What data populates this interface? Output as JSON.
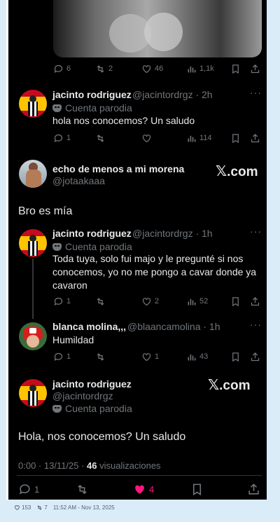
{
  "top_tweet": {
    "replies": "6",
    "retweets": "2",
    "likes": "46",
    "views": "1,1k"
  },
  "reply1": {
    "name": "jacinto rodriguez",
    "handle": "@jacintordrgz · 2h",
    "parody": "Cuenta parodia",
    "text": "hola nos conocemos? Un saludo",
    "replies": "1",
    "retweets": "",
    "likes": "",
    "views": "114"
  },
  "embed1": {
    "name": "echo de menos a mi morena",
    "handle": "@jotaakaaa",
    "brand": ".com",
    "text": "Bro es mía"
  },
  "reply2": {
    "name": "jacinto rodriguez",
    "handle": "@jacintordrgz · 1h",
    "parody": "Cuenta parodia",
    "text": "Toda tuya, solo fui majo y le pregunté si nos conocemos, yo no me pongo a cavar donde ya cavaron",
    "replies": "1",
    "retweets": "",
    "likes": "2",
    "views": "52"
  },
  "reply3": {
    "name": "blanca molina,,,",
    "handle": "@blaancamolina · 1h",
    "text": "Humildad",
    "replies": "1",
    "retweets": "",
    "likes": "1",
    "views": "43"
  },
  "main": {
    "name": "jacinto rodriguez",
    "handle": "@jacintordrgz",
    "parody": "Cuenta parodia",
    "brand": ".com",
    "text": "Hola, nos conocemos? Un saludo",
    "timestamp": "0:00 · 13/11/25 · ",
    "views_count": "46",
    "views_label": " visualizaciones",
    "replies": "1",
    "likes": "4"
  },
  "footer": {
    "likes": "153",
    "retweets": "7",
    "timestamp": "11:52 AM - Nov 13, 2025"
  },
  "colors": {
    "background": "#000000",
    "text": "#e7e9ea",
    "muted": "#71767b",
    "like_active": "#f91880"
  }
}
